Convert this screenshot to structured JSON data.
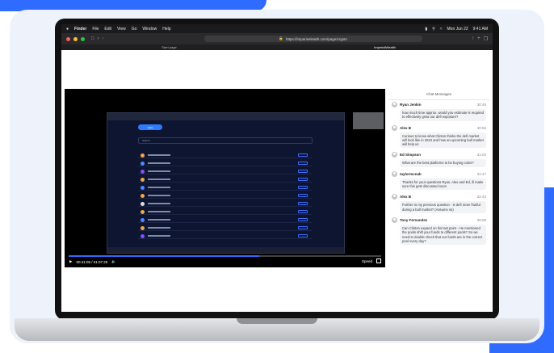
{
  "menubar": {
    "items": [
      "Finder",
      "File",
      "Edit",
      "View",
      "Go",
      "Window",
      "Help"
    ],
    "date": "Mon Jun 22",
    "time": "9:41 AM"
  },
  "browser": {
    "url": "https://impariseleaith.com/page/crypto",
    "tabs": [
      "Start page",
      "ImperialWealth"
    ]
  },
  "video": {
    "inner_button": "Hello",
    "inner_search": "Search",
    "time": "00:41:05 / 01:07:25",
    "speed": "Speed"
  },
  "chat": {
    "title": "Chat Messages",
    "messages": [
      {
        "name": "Ryan Jenkin",
        "time": "30:48",
        "text": "how much time approx. would you estimate is required to effectively grow our defi exposure?"
      },
      {
        "name": "Alex B",
        "time": "30:56",
        "text": "Curious to know what Clinton thinks the defi market will look like in 2023 and how an upcoming bull market will help us"
      },
      {
        "name": "Ed Simpson",
        "time": "31:02",
        "text": "What are the best platforms to be buying coins?"
      },
      {
        "name": "taylormcnab",
        "time": "31:47",
        "text": "Thanks for your questions Ryan, Alex and Ed, ill make sure this gets discussed soon"
      },
      {
        "name": "Alex B",
        "time": "32:43",
        "text": "Further to my previous question - is defi more fruitful during a bull market? (Assume so)"
      },
      {
        "name": "Tony Fernandez",
        "time": "36:08",
        "text": "Can Clinton expand on his last point - He mentioned the pools shift your funds to different pools? So we need to double check that our funds are in the correct pool every day?"
      }
    ]
  },
  "colors": {
    "accent": "#2f6bff"
  }
}
